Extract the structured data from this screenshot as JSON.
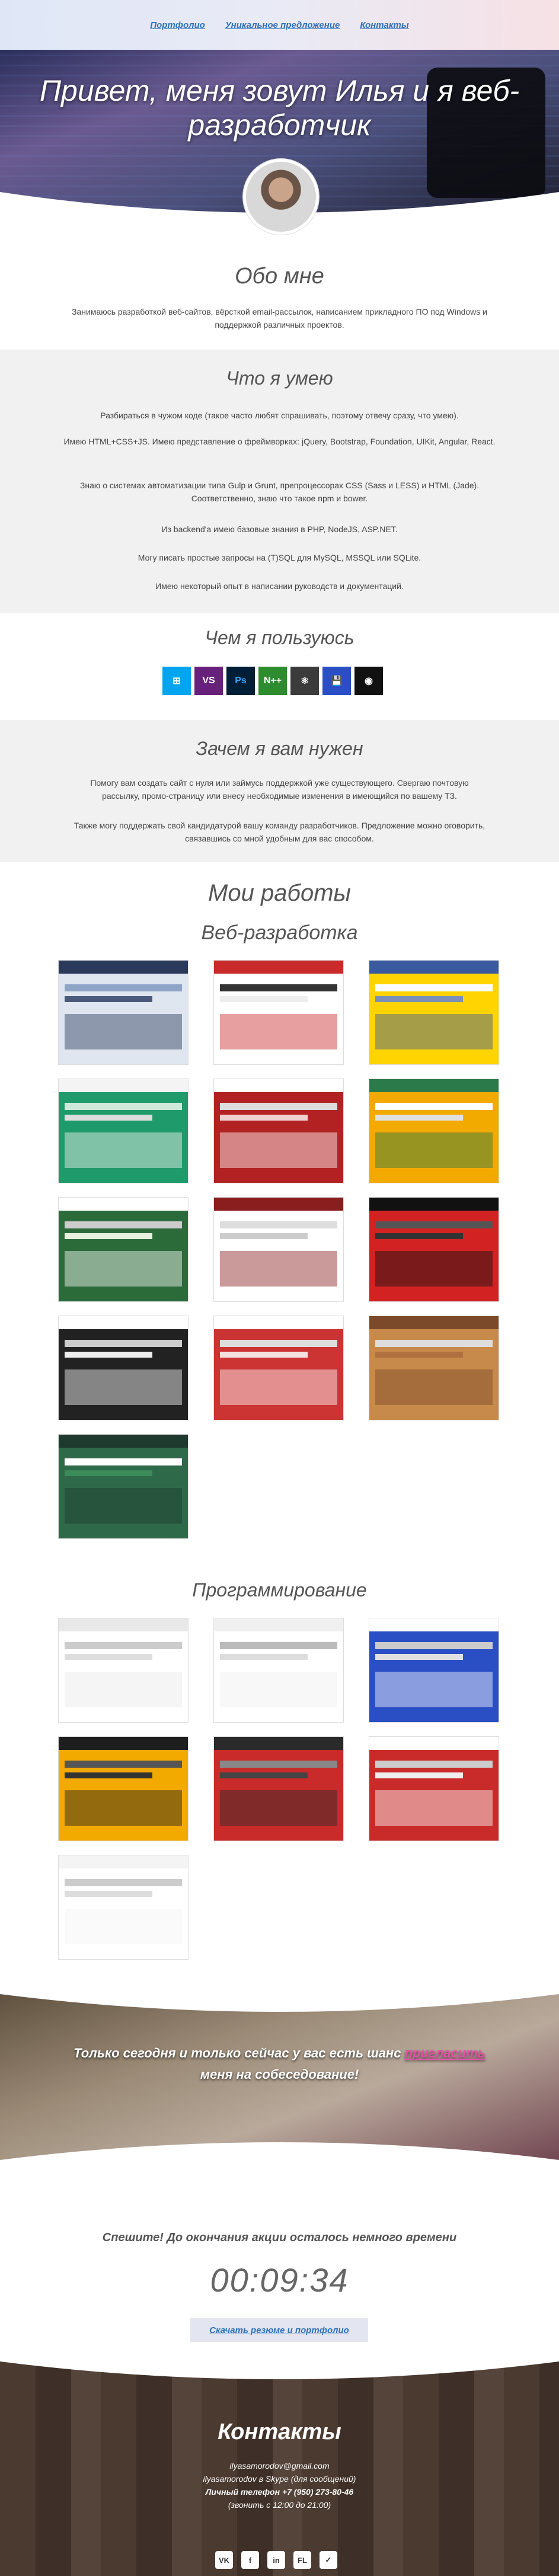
{
  "nav": {
    "items": [
      "Портфолио",
      "Уникальное предложение",
      "Контакты"
    ]
  },
  "hero": {
    "title": "Привет, меня зовут Илья и я веб-разработчик"
  },
  "about": {
    "title": "Обо мне",
    "text": "Занимаюсь разработкой веб-сайтов, вёрсткой email-рассылок, написанием прикладного ПО под Windows и поддержкой различных проектов."
  },
  "skills": {
    "title": "Что я умею",
    "p1": "Разбираться в чужом коде (такое часто любят спрашивать, поэтому отвечу сразу, что умею).",
    "p2": "Имею HTML+CSS+JS. Имею представление о фреймворках: jQuery, Bootstrap, Foundation, UIKit, Angular, React.",
    "p3": "Знаю о системах автоматизации типа Gulp и Grunt, препроцессорах CSS (Sass и LESS) и HTML (Jade). Соответственно, знаю что такое npm и bower.",
    "p4": "Из backend'a имею базовые знания в PHP, NodeJS, ASP.NET.",
    "p5": "Могу писать простые запросы на (T)SQL для MySQL, MSSQL или SQLite.",
    "p6": "Имею некоторый опыт в написании руководств и документаций."
  },
  "tools": {
    "title": "Чем я пользуюсь",
    "items": [
      {
        "icon": "windows-icon",
        "color": "#00a4ef"
      },
      {
        "icon": "visual-studio-icon",
        "color": "#68217a"
      },
      {
        "icon": "photoshop-icon",
        "color": "#001e36"
      },
      {
        "icon": "notepad-plus-plus-icon",
        "color": "#2d8c2d"
      },
      {
        "icon": "atom-icon",
        "color": "#3b3b3b"
      },
      {
        "icon": "floppy-save-icon",
        "color": "#2a4ec4"
      },
      {
        "icon": "github-icon",
        "color": "#111111"
      }
    ]
  },
  "why": {
    "title": "Зачем я вам нужен",
    "p1": "Помогу вам создать сайт с нуля или займусь поддержкой уже существующего. Свергаю почтовую рассылку, промо-страницу или внесу необходимые изменения в имеющийся по вашему ТЗ.",
    "p2": "Также могу поддержать свой кандидатурой вашу команду разработчиков. Предложение можно оговорить, связавшись со мной удобным для вас способом."
  },
  "works": {
    "title": "Мои работы",
    "web_title": "Веб-разработка",
    "prog_title": "Программирование"
  },
  "offer": {
    "line1_a": "Только сегодня и только сейчас у вас есть шанс ",
    "line1_link": "пригласить",
    "line2": "меня на собеседование!"
  },
  "timer": {
    "title": "Спешите! До окончания акции осталось немного времени",
    "value": "00:09:34",
    "button": "Скачать резюме и портфолио"
  },
  "contacts": {
    "title": "Контакты",
    "email": "ilyasamorodov@gmail.com",
    "skype": "ilyasamorodov в Skype (для сообщений)",
    "phone": "Личный телефон +7 (950) 273-80-46",
    "hours": "(звонить с 12:00 до 21:00)",
    "socials": [
      "VK",
      "f",
      "in",
      "FL",
      "✓"
    ]
  }
}
